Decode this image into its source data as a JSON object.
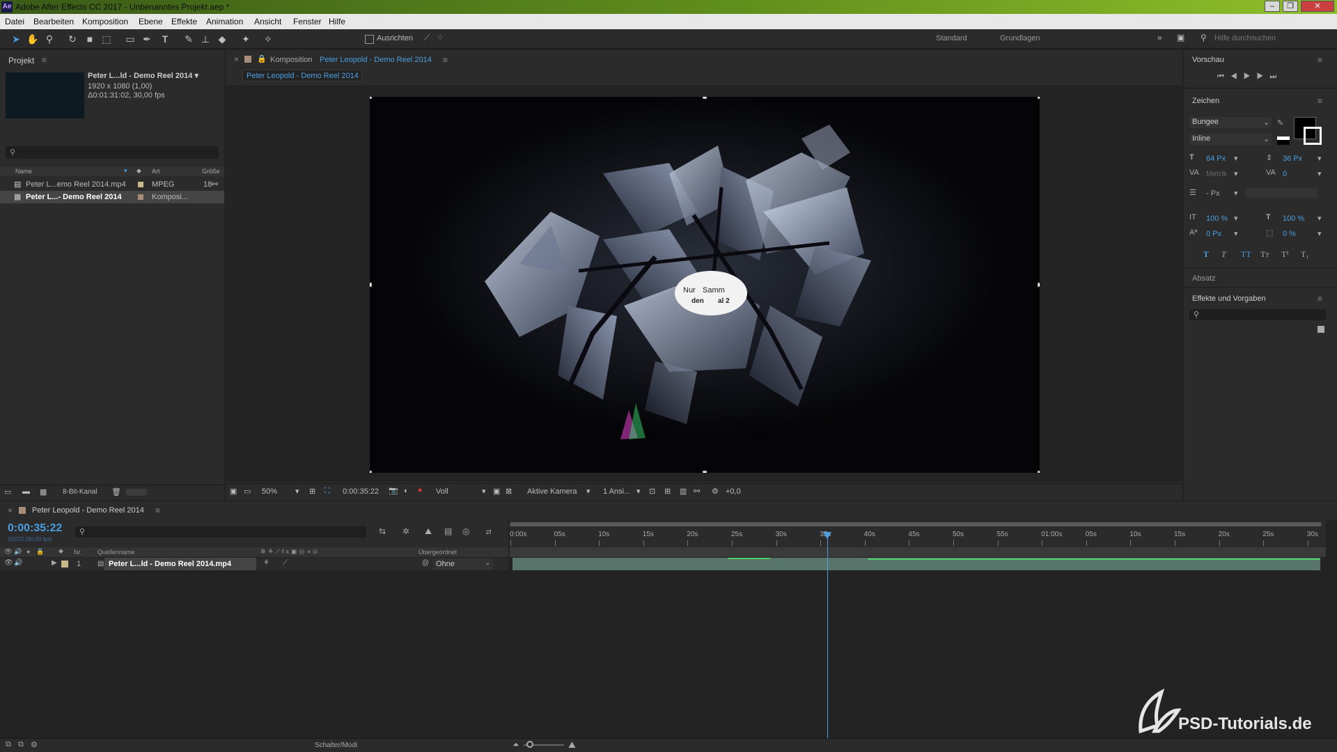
{
  "app": {
    "title": "Adobe After Effects CC 2017 - Unbenanntes Projekt.aep *",
    "icon": "Ae"
  },
  "window_controls": {
    "minimize": "–",
    "maximize": "❐",
    "close": "✕"
  },
  "menu": [
    "Datei",
    "Bearbeiten",
    "Komposition",
    "Ebene",
    "Effekte",
    "Animation",
    "Ansicht",
    "Fenster",
    "Hilfe"
  ],
  "toolbar": {
    "snap_label": "Ausrichten",
    "workspace1": "Standard",
    "workspace2": "Grundlagen",
    "search_placeholder": "Hilfe durchsuchen"
  },
  "project": {
    "title": "Projekt",
    "preview_name": "Peter L...ld - Demo Reel 2014 ▾",
    "preview_res": "1920 x 1080 (1,00)",
    "preview_dur": "Δ0:01:31:02, 30,00 fps",
    "columns": {
      "name": "Name",
      "type": "Art",
      "size": "Größe"
    },
    "items": [
      {
        "name": "Peter L...emo Reel 2014.mp4",
        "type": "MPEG",
        "size": "18"
      },
      {
        "name": "Peter L...- Demo Reel 2014",
        "type": "Komposi...",
        "size": ""
      }
    ],
    "bitdepth": "8-Bit-Kanal"
  },
  "comp": {
    "tab_prefix": "Komposition",
    "tab_name": "Peter Leopold - Demo Reel 2014",
    "subtab": "Peter Leopold - Demo Reel 2014",
    "zoom": "50%",
    "timecode": "0:00:35:22",
    "resolution": "Voll",
    "camera": "Aktive Kamera",
    "views": "1 Ansi...",
    "exposure": "+0,0",
    "overlay_text_1": "Nur",
    "overlay_text_2": "Samm",
    "overlay_text_3": "den",
    "overlay_text_4": "al 2"
  },
  "right": {
    "preview_title": "Vorschau",
    "character_title": "Zeichen",
    "font": "Bungee",
    "style": "Inline",
    "font_size": "64 Px",
    "leading": "36 Px",
    "kerning": "Metrik",
    "tracking": "0",
    "stroke": "- Px",
    "vscale": "100 %",
    "hscale": "100 %",
    "baseline": "0 Px",
    "tsume": "0 %",
    "styles": [
      "T",
      "T",
      "TT",
      "Tт",
      "T¹",
      "T₁"
    ],
    "paragraph_title": "Absatz",
    "effects_title": "Effekte und Vorgaben"
  },
  "timeline": {
    "tab": "Peter Leopold - Demo Reel 2014",
    "timecode": "0:00:35:22",
    "fps_sub": "01072 (30.00 fps)",
    "col_nr": "Nr.",
    "col_source": "Quellenname",
    "col_parent": "Übergeordnet",
    "layer": {
      "nr": "1",
      "name": "Peter L...ld - Demo Reel 2014.mp4",
      "parent": "Ohne"
    },
    "ticks": [
      "0:00s",
      "05s",
      "10s",
      "15s",
      "20s",
      "25s",
      "30s",
      "35s",
      "40s",
      "45s",
      "50s",
      "55s",
      "01:00s",
      "05s",
      "10s",
      "15s",
      "20s",
      "25s",
      "30s"
    ],
    "playhead_seconds": 35.73,
    "switches_label": "Schalter/Modi"
  },
  "watermark": "PSD-Tutorials.de",
  "colors": {
    "accent": "#4a9fe0",
    "titlebar": "#6a9f1f",
    "panel": "#2b2b2b",
    "bg": "#232323"
  }
}
